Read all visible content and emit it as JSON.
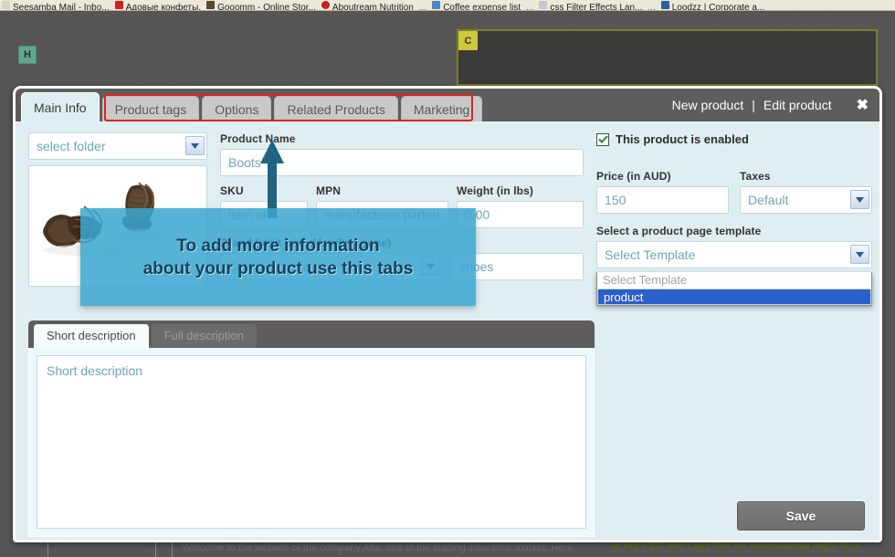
{
  "browser": {
    "bookmarks": [
      {
        "label": "Seesamba Mail - Inbo...",
        "color": "#d8d4c0"
      },
      {
        "label": "Адовые конфеты.",
        "color": "#cc2222"
      },
      {
        "label": "Gooomm - Online Stor...",
        "color": "#5a4632"
      },
      {
        "label": "Aboutream Nutrition",
        "color": "#cc1f1f"
      },
      {
        "label": "...",
        "color": "#ece9d8"
      },
      {
        "label": "Coffee expense list",
        "color": "#4a86c5"
      },
      {
        "label": "...",
        "color": "#ece9d8"
      },
      {
        "label": "css Filter Effects Lan...",
        "color": "#c8c8c8"
      },
      {
        "label": "...",
        "color": "#ece9d8"
      },
      {
        "label": "Loodzz | Corporate a...",
        "color": "#2c5f9e"
      }
    ]
  },
  "background": {
    "badge_h": "H",
    "badge_c": "C",
    "site_text_left": "Welcome to the website of the company Alfa, one of the leading insurance market. Here",
    "site_text_right": "In For CEO and Lays Out An International High-Tech"
  },
  "dialog": {
    "tabs": [
      {
        "label": "Main Info",
        "active": true
      },
      {
        "label": "Product tags",
        "active": false
      },
      {
        "label": "Options",
        "active": false
      },
      {
        "label": "Related Products",
        "active": false
      },
      {
        "label": "Marketing",
        "active": false
      }
    ],
    "header_links": {
      "new_product": "New product",
      "separator": "|",
      "edit_product": "Edit product",
      "close": "✖"
    },
    "left": {
      "folder_select_value": "select folder",
      "thumbnail_alt": "product-boots-photo"
    },
    "main": {
      "product_name_label": "Product Name",
      "product_name_value": "Boots",
      "sku_label": "SKU",
      "sku_placeholder": "item id",
      "mpn_label": "MPN",
      "mpn_placeholder": "manufacturer partnur",
      "weight_label": "Weight (in lbs)",
      "weight_value": "0.00",
      "brand_label": "Brand (visit brand landing page)",
      "brand_select_value": "Select a brand",
      "brand_tag_value": "shoes"
    },
    "right": {
      "enabled_label": "This product is enabled",
      "enabled_checked": true,
      "price_label": "Price (in AUD)",
      "price_value": "150",
      "taxes_label": "Taxes",
      "taxes_value": "Default",
      "template_label": "Select a product page template",
      "template_value": "Select Template",
      "template_options": [
        {
          "label": "Select Template",
          "state": "muted"
        },
        {
          "label": "product",
          "state": "selected"
        }
      ]
    },
    "description": {
      "tabs": [
        {
          "label": "Short description",
          "active": true
        },
        {
          "label": "Full description",
          "active": false
        }
      ],
      "placeholder": "Short description"
    },
    "save_label": "Save"
  },
  "annotation": {
    "callout_line1": "To add more information",
    "callout_line2": "about your product use this tabs",
    "accent_color": "#3aa6d0",
    "arrow_color": "#1f6480",
    "highlight_color": "#e02020"
  }
}
